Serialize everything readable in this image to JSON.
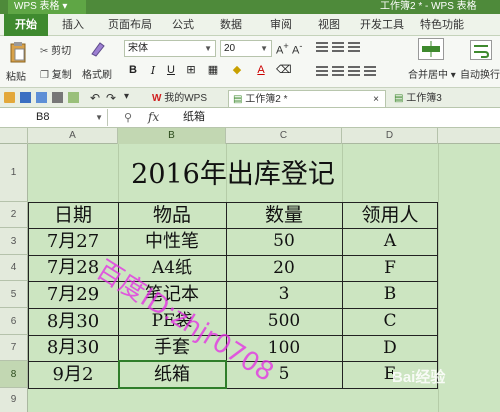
{
  "app": {
    "name": "WPS 表格",
    "window_title": "工作簿2 * - WPS 表格"
  },
  "menu": {
    "items": [
      "开始",
      "插入",
      "页面布局",
      "公式",
      "数据",
      "审阅",
      "视图",
      "开发工具",
      "特色功能"
    ]
  },
  "ribbon": {
    "paste": "粘贴",
    "cut": "剪切",
    "copy": "复制",
    "format_painter": "格式刷",
    "font_name": "宋体",
    "font_size": "20",
    "bold": "B",
    "italic": "I",
    "underline": "U",
    "font_color_label": "A",
    "merge_center": "合并居中",
    "wrap_text": "自动换行"
  },
  "tabs": [
    {
      "label": "我的WPS",
      "active": false
    },
    {
      "label": "工作簿2 *",
      "active": true
    },
    {
      "label": "工作簿3",
      "active": false
    }
  ],
  "formula_bar": {
    "cell_ref": "B8",
    "fx": "fx",
    "value": "纸箱"
  },
  "columns": [
    "A",
    "B",
    "C",
    "D"
  ],
  "rows": [
    "1",
    "2",
    "3",
    "4",
    "5",
    "6",
    "7",
    "8",
    "9"
  ],
  "sheet": {
    "title": "2016年出库登记",
    "headers": [
      "日期",
      "物品",
      "数量",
      "领用人"
    ],
    "data": [
      [
        "7月27",
        "中性笔",
        "50",
        "A"
      ],
      [
        "7月28",
        "A4纸",
        "20",
        "F"
      ],
      [
        "7月29",
        "笔记本",
        "3",
        "B"
      ],
      [
        "8月30",
        "PE袋",
        "500",
        "C"
      ],
      [
        "8月30",
        "手套",
        "100",
        "D"
      ],
      [
        "9月2",
        "纸箱",
        "5",
        "E"
      ]
    ]
  },
  "watermark": "百度ID:zhjr0708",
  "baidu_logo": "Bai经验",
  "colors": {
    "accent": "#3f8a2f",
    "grid_bg": "#cce5c1",
    "watermark": "#e628e6"
  }
}
